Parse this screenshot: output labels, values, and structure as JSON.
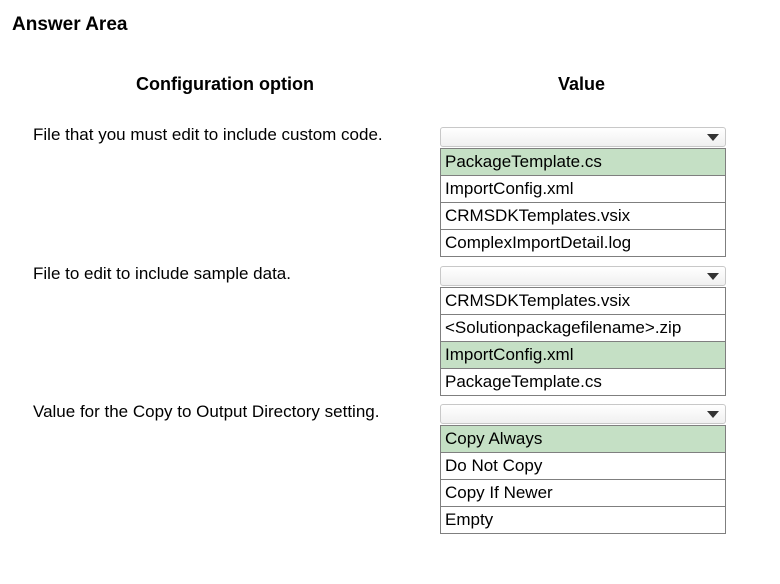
{
  "answer_area": {
    "title": "Answer Area"
  },
  "columns": {
    "config_header": "Configuration option",
    "value_header": "Value"
  },
  "rows": [
    {
      "prompt": "File that you must edit to include custom code.",
      "options": [
        "PackageTemplate.cs",
        "ImportConfig.xml",
        "CRMSDKTemplates.vsix",
        "ComplexImportDetail.log"
      ],
      "selected_index": 0
    },
    {
      "prompt": "File to edit to include sample data.",
      "options": [
        "CRMSDKTemplates.vsix",
        "<Solutionpackagefilename>.zip",
        "ImportConfig.xml",
        "PackageTemplate.cs"
      ],
      "selected_index": 2
    },
    {
      "prompt": "Value for the Copy to Output Directory setting.",
      "options": [
        "Copy Always",
        "Do Not Copy",
        "Copy If Newer",
        "Empty"
      ],
      "selected_index": 0
    }
  ],
  "colors": {
    "selected_highlight": "#c5e0c5",
    "option_border": "#7f7f7f"
  },
  "icons": {
    "dropdown": "chevron-down-icon"
  }
}
